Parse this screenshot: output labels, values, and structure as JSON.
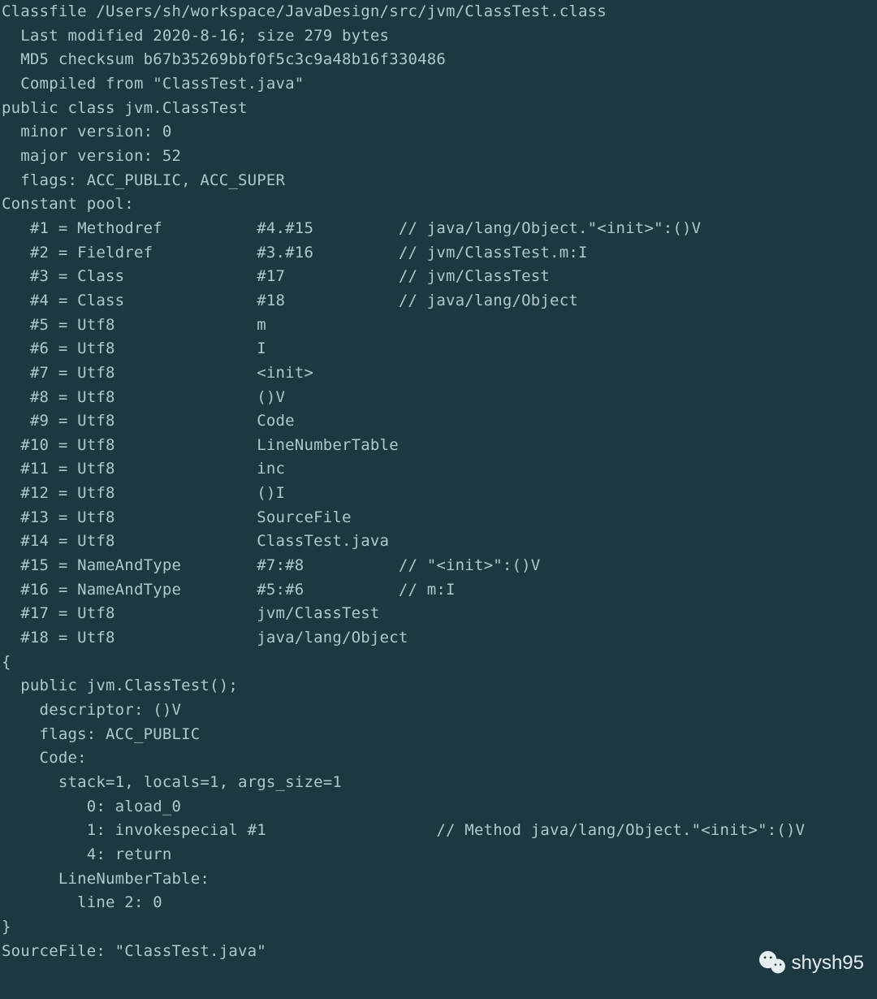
{
  "header": {
    "classfile": "Classfile /Users/sh/workspace/JavaDesign/src/jvm/ClassTest.class",
    "last_modified": "  Last modified 2020-8-16; size 279 bytes",
    "md5": "  MD5 checksum b67b35269bbf0f5c3c9a48b16f330486",
    "compiled_from": "  Compiled from \"ClassTest.java\"",
    "class_decl": "public class jvm.ClassTest",
    "minor": "  minor version: 0",
    "major": "  major version: 52",
    "flags": "  flags: ACC_PUBLIC, ACC_SUPER"
  },
  "constant_pool_label": "Constant pool:",
  "cp": [
    "   #1 = Methodref          #4.#15         // java/lang/Object.\"<init>\":()V",
    "   #2 = Fieldref           #3.#16         // jvm/ClassTest.m:I",
    "   #3 = Class              #17            // jvm/ClassTest",
    "   #4 = Class              #18            // java/lang/Object",
    "   #5 = Utf8               m",
    "   #6 = Utf8               I",
    "   #7 = Utf8               <init>",
    "   #8 = Utf8               ()V",
    "   #9 = Utf8               Code",
    "  #10 = Utf8               LineNumberTable",
    "  #11 = Utf8               inc",
    "  #12 = Utf8               ()I",
    "  #13 = Utf8               SourceFile",
    "  #14 = Utf8               ClassTest.java",
    "  #15 = NameAndType        #7:#8          // \"<init>\":()V",
    "  #16 = NameAndType        #5:#6          // m:I",
    "  #17 = Utf8               jvm/ClassTest",
    "  #18 = Utf8               java/lang/Object"
  ],
  "body": {
    "open_brace": "{",
    "ctor_decl": "  public jvm.ClassTest();",
    "descriptor": "    descriptor: ()V",
    "ctor_flags": "    flags: ACC_PUBLIC",
    "code_label": "    Code:",
    "stack_line": "      stack=1, locals=1, args_size=1",
    "instr0": "         0: aload_0",
    "instr1": "         1: invokespecial #1                  // Method java/lang/Object.\"<init>\":()V",
    "instr4": "         4: return",
    "lnt_label": "      LineNumberTable:",
    "lnt_entry": "        line 2: 0",
    "close_brace": "}"
  },
  "sourcefile": "SourceFile: \"ClassTest.java\"",
  "watermark": "shysh95"
}
